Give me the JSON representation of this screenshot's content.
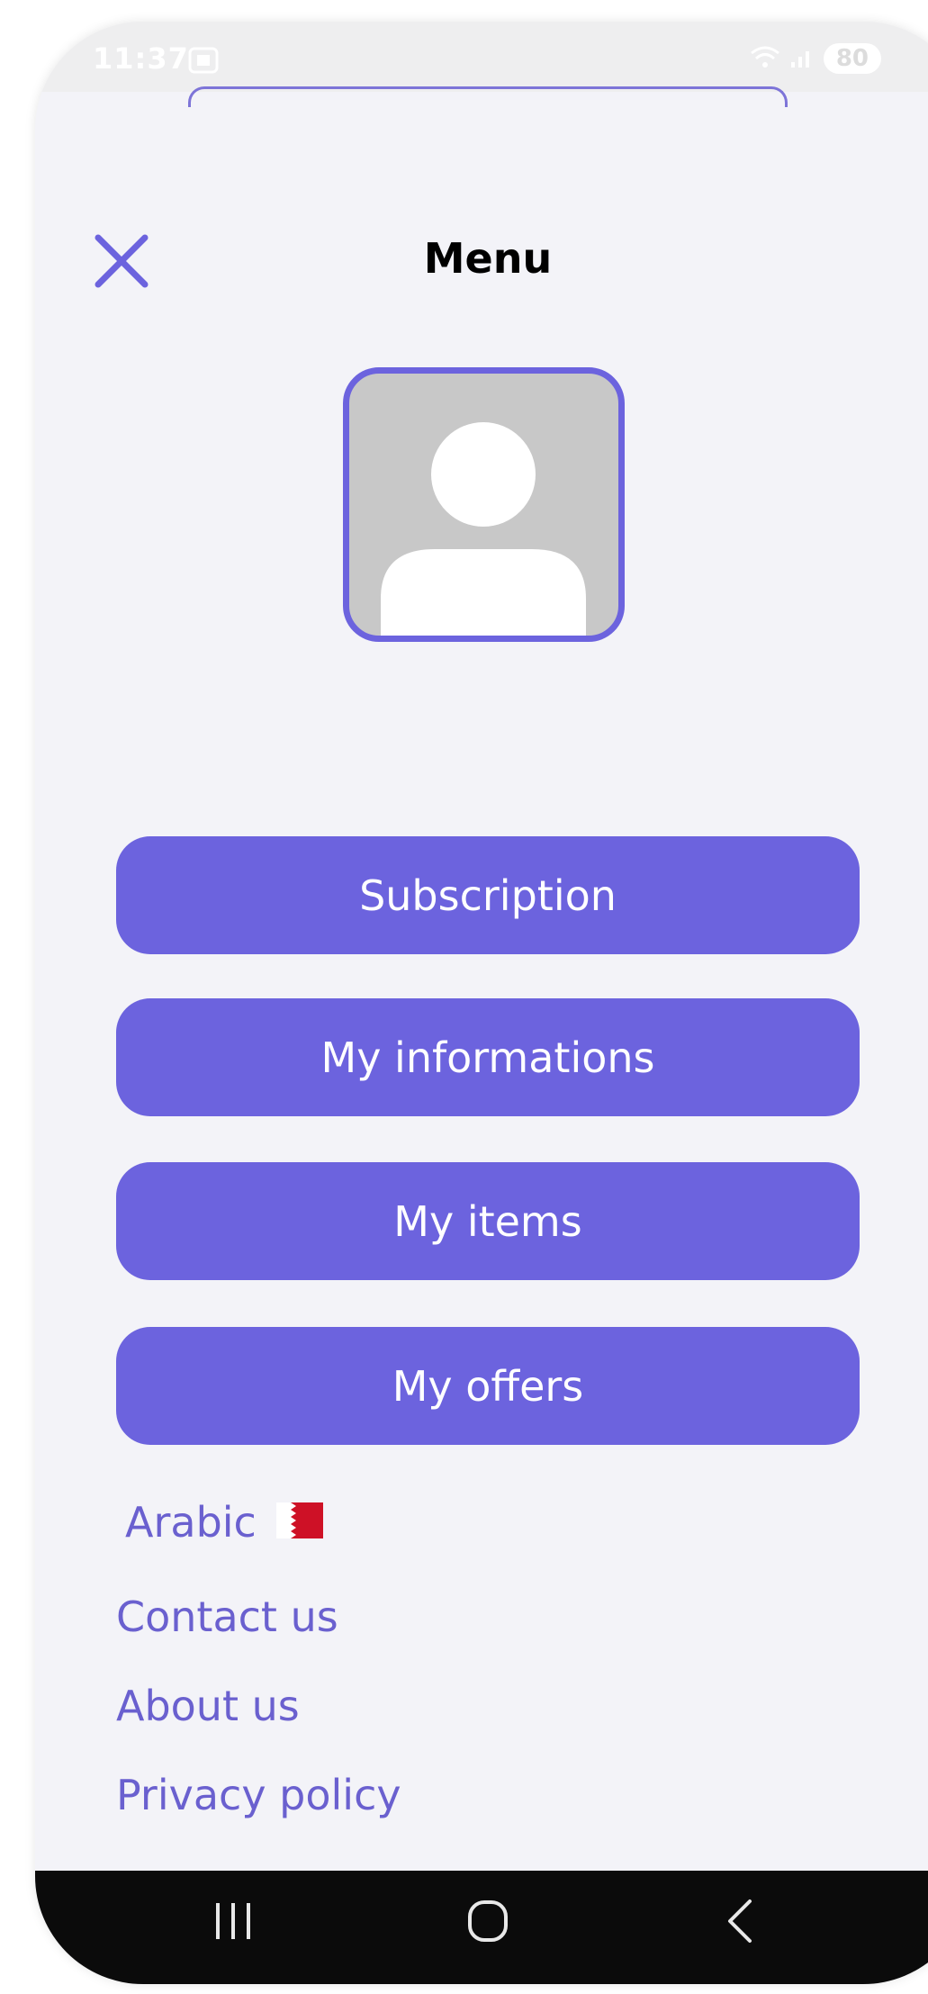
{
  "status": {
    "time": "11:37",
    "battery": "80"
  },
  "header": {
    "title": "Menu"
  },
  "menu": {
    "buttons": [
      {
        "label": "Subscription"
      },
      {
        "label": "My informations"
      },
      {
        "label": "My items"
      },
      {
        "label": "My offers"
      }
    ],
    "language": {
      "label": "Arabic",
      "flag": "bahrain-flag"
    },
    "links": [
      {
        "label": "Contact us"
      },
      {
        "label": "About us"
      },
      {
        "label": "Privacy policy"
      }
    ]
  },
  "colors": {
    "accent": "#6c63de",
    "link": "#6a60cf",
    "background": "#f3f3f8"
  },
  "icons": {
    "close": "close-icon",
    "avatar": "user-placeholder-icon",
    "nav_recents": "recent-apps-icon",
    "nav_home": "home-icon",
    "nav_back": "back-icon"
  }
}
